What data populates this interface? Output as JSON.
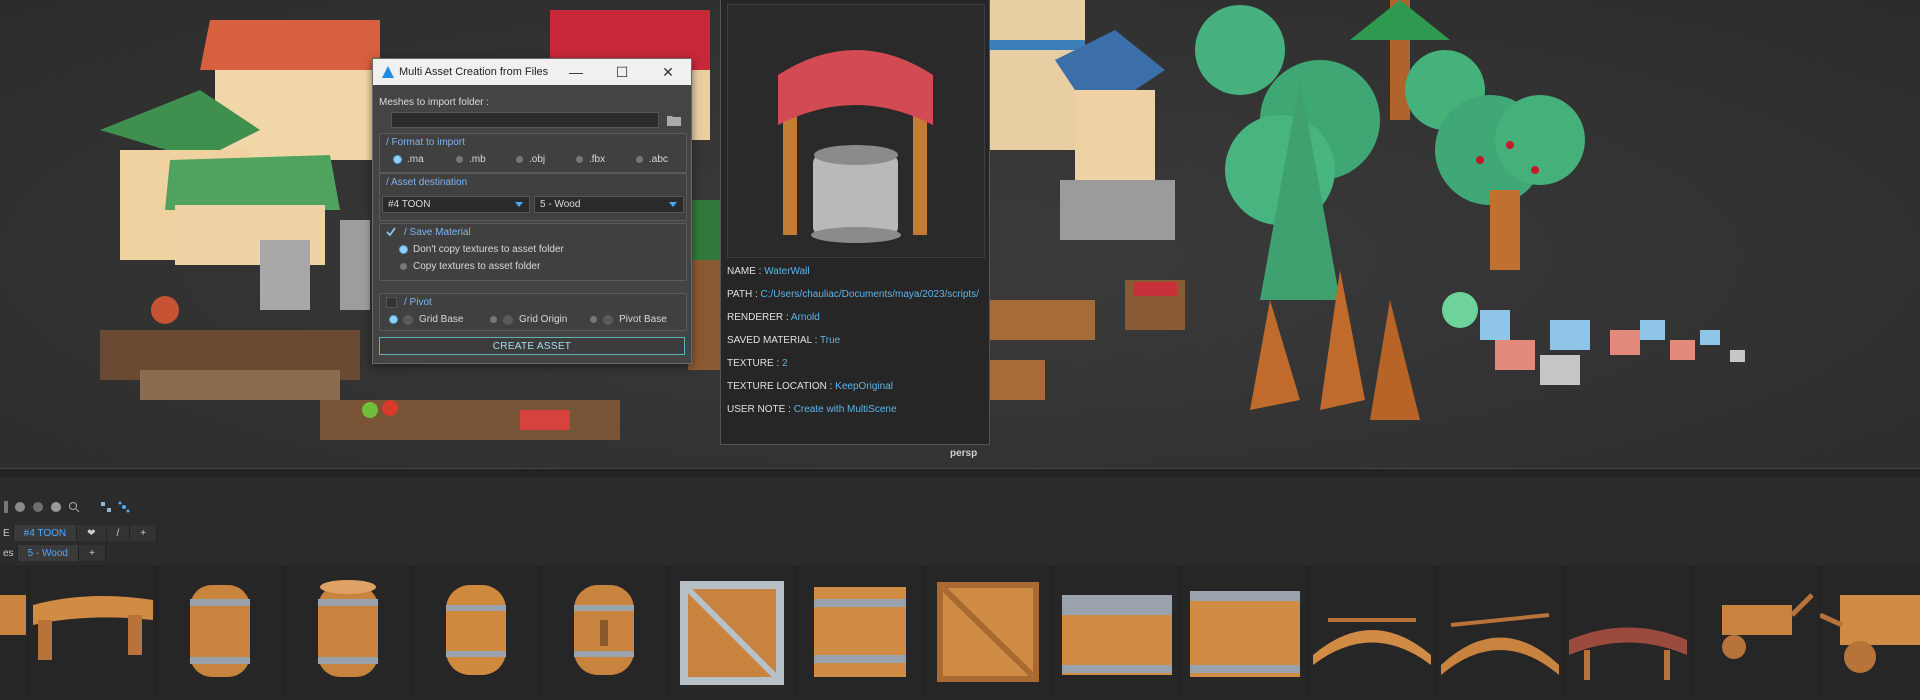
{
  "viewport": {
    "camera_label": "persp"
  },
  "dialog": {
    "title": "Multi Asset Creation from Files",
    "meshes_label": "Meshes to import folder :",
    "meshes_value": "",
    "format_title": "/ Format to import",
    "formats": [
      ".ma",
      ".mb",
      ".obj",
      ".fbx",
      ".abc"
    ],
    "format_selected": ".ma",
    "destination_title": "/ Asset destination",
    "destination_category": "#4 TOON",
    "destination_sub": "5 - Wood",
    "save_material_title": "/ Save Material",
    "save_material_checked": true,
    "material_options": [
      "Don't copy textures to asset folder",
      "Copy textures to asset folder"
    ],
    "pivot_title": "/ Pivot",
    "pivot_options": [
      "Grid Base",
      "Grid Origin",
      "Pivot Base"
    ],
    "create_label": "CREATE ASSET"
  },
  "info": {
    "rows": [
      {
        "key": "NAME : ",
        "value": "WaterWall"
      },
      {
        "key": "PATH : ",
        "value": "C:/Users/chauliac/Documents/maya/2023/scripts/"
      },
      {
        "key": "RENDERER : ",
        "value": "Arnold"
      },
      {
        "key": "SAVED MATERIAL : ",
        "value": "True"
      },
      {
        "key": "TEXTURE : ",
        "value": "2"
      },
      {
        "key": "TEXTURE LOCATION : ",
        "value": "KeepOriginal"
      },
      {
        "key": "USER NOTE : ",
        "value": "Create with MultiScene"
      }
    ]
  },
  "lower": {
    "tabs_row1": [
      "#4 TOON",
      "❤",
      "/",
      "+"
    ],
    "row2_prefix": "es",
    "tabs_row2": [
      "5 - Wood",
      "+"
    ]
  },
  "colors": {
    "accent": "#4fa8ff",
    "value": "#5fb4e8",
    "wood": "#c8833e",
    "metal": "#9aa3ad"
  }
}
